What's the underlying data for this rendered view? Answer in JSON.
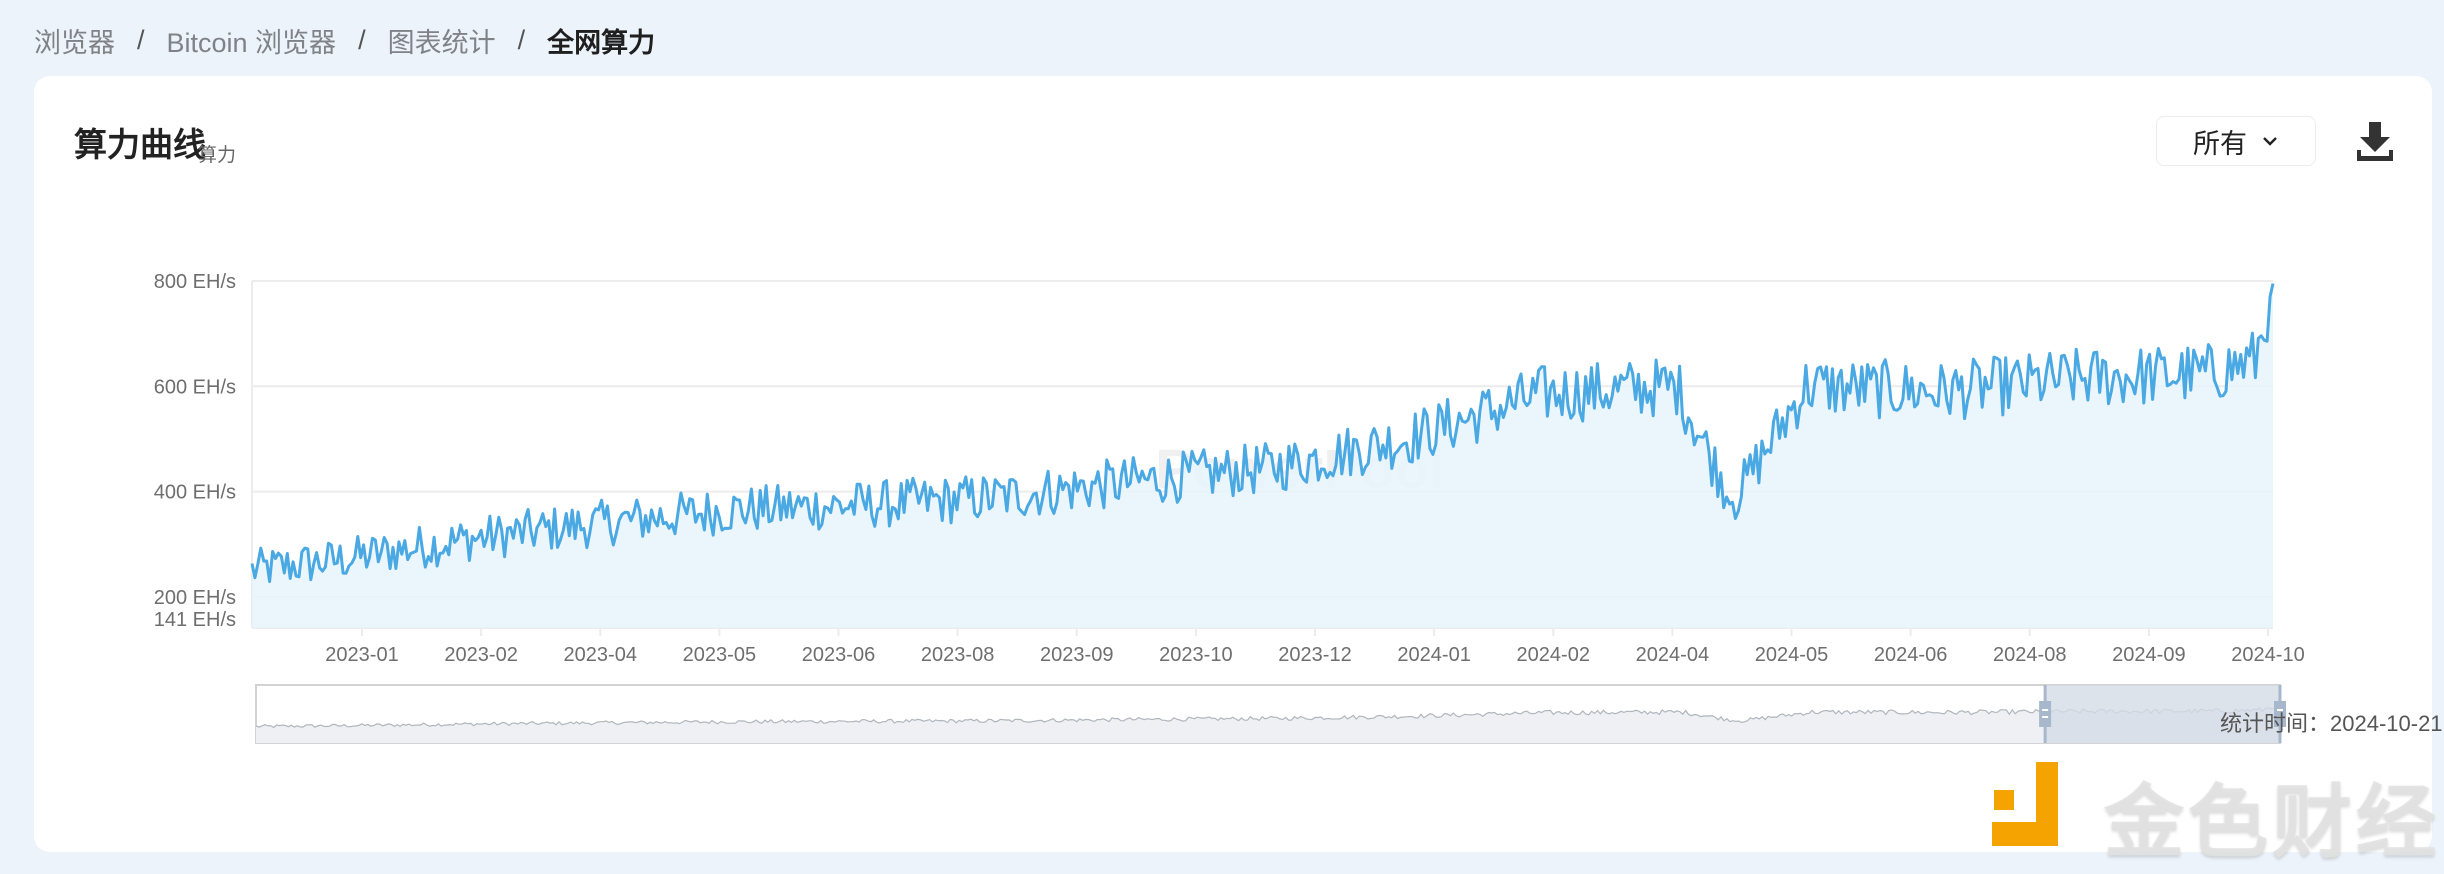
{
  "breadcrumb": {
    "items": [
      "浏览器",
      "Bitcoin 浏览器",
      "图表统计"
    ],
    "current": "全网算力",
    "separator": "/"
  },
  "card": {
    "title": "算力曲线",
    "range_select": {
      "value": "所有",
      "icon": "chevron-down-icon"
    },
    "download": {
      "icon": "download-icon"
    }
  },
  "footer": {
    "stat_time": "统计时间：2024-10-21"
  },
  "watermarks": {
    "chart_watermark": "PowerPool",
    "brand_text": "金色财经"
  },
  "colors": {
    "line": "#4aa8e3",
    "area": "#e8f4fb",
    "grid": "#ececec",
    "axis_text": "#6e6e6e",
    "slider_selected": "#d5dce6",
    "slider_handle": "#a7b7cc",
    "brand_orange": "#f5a300"
  },
  "chart_data": {
    "type": "area",
    "title": "算力曲线",
    "ylabel": "算力",
    "xlabel": "",
    "unit": "EH/s",
    "ylim": [
      141,
      800
    ],
    "y_ticks": [
      {
        "value": 141,
        "label": "141 EH/s"
      },
      {
        "value": 200,
        "label": "200 EH/s"
      },
      {
        "value": 400,
        "label": "400 EH/s"
      },
      {
        "value": 600,
        "label": "600 EH/s"
      },
      {
        "value": 800,
        "label": "800 EH/s"
      }
    ],
    "x_tick_labels": [
      "2023-01",
      "2023-02",
      "2023-04",
      "2023-05",
      "2023-06",
      "2023-08",
      "2023-09",
      "2023-10",
      "2023-12",
      "2024-01",
      "2024-02",
      "2024-04",
      "2024-05",
      "2024-06",
      "2024-08",
      "2024-09",
      "2024-10"
    ],
    "x_range": [
      "2022-12",
      "2024-10-21"
    ],
    "grid": true,
    "legend": "none",
    "series": [
      {
        "name": "全网算力",
        "trend_points": [
          {
            "x": "2022-12-01",
            "y": 250
          },
          {
            "x": "2023-01-01",
            "y": 270
          },
          {
            "x": "2023-02-15",
            "y": 310
          },
          {
            "x": "2023-04-01",
            "y": 340
          },
          {
            "x": "2023-05-15",
            "y": 365
          },
          {
            "x": "2023-06-30",
            "y": 375
          },
          {
            "x": "2023-08-15",
            "y": 390
          },
          {
            "x": "2023-09-30",
            "y": 420
          },
          {
            "x": "2023-11-15",
            "y": 445
          },
          {
            "x": "2023-12-31",
            "y": 500
          },
          {
            "x": "2024-02-15",
            "y": 585
          },
          {
            "x": "2024-04-01",
            "y": 600
          },
          {
            "x": "2024-04-20",
            "y": 380
          },
          {
            "x": "2024-05-15",
            "y": 600
          },
          {
            "x": "2024-06-30",
            "y": 590
          },
          {
            "x": "2024-08-15",
            "y": 615
          },
          {
            "x": "2024-09-30",
            "y": 625
          },
          {
            "x": "2024-10-15",
            "y": 650
          },
          {
            "x": "2024-10-21",
            "y": 795
          }
        ],
        "volatility": 45
      }
    ],
    "data_zoom": {
      "start_fraction": 0.88,
      "end_fraction": 1.0
    }
  }
}
